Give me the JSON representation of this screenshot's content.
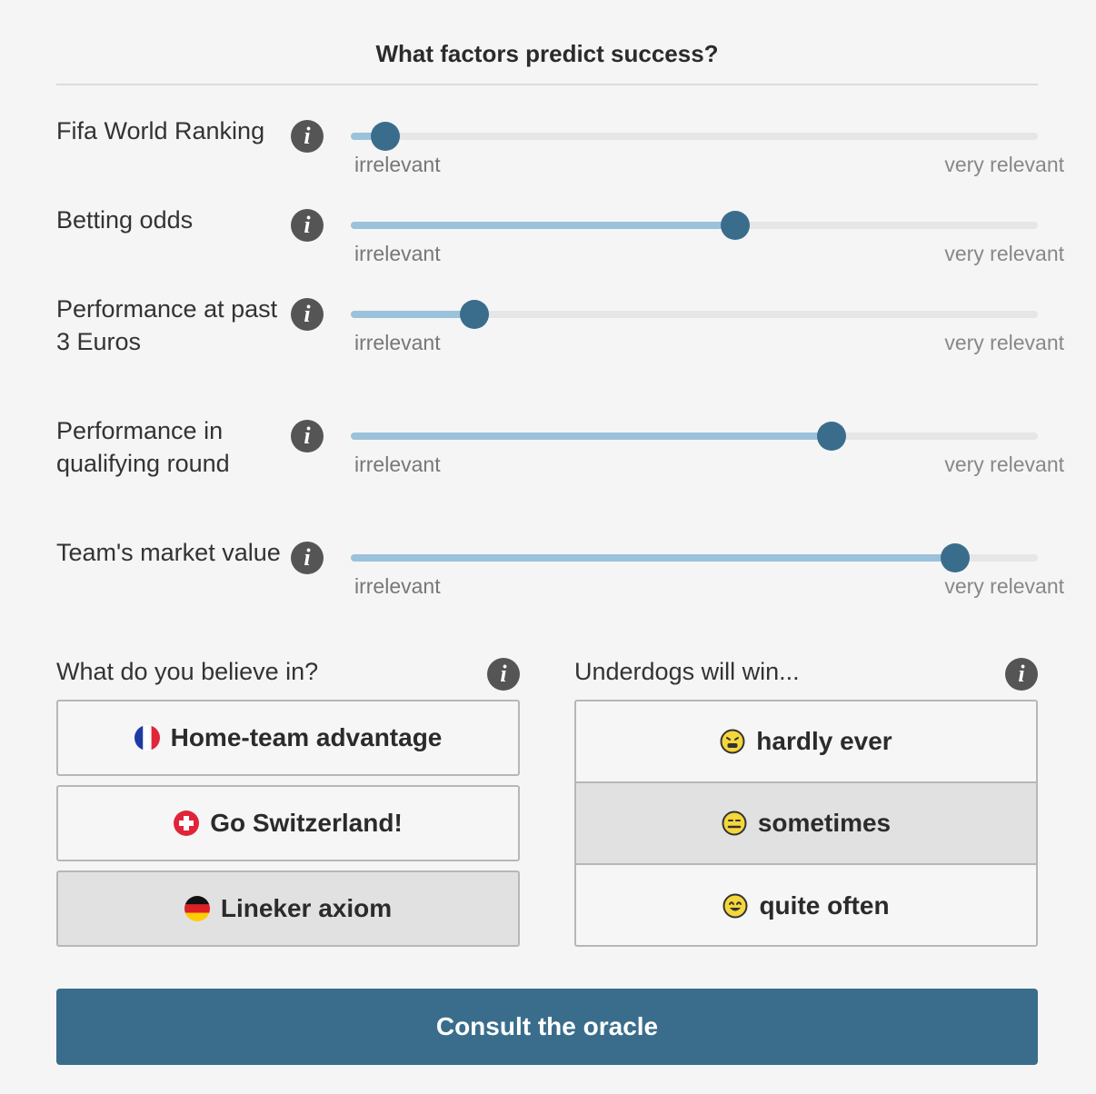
{
  "header": {
    "title": "What factors predict success?"
  },
  "colors": {
    "accent": "#3a6d8c",
    "fill": "#9bc2da",
    "track": "#e6e6e6"
  },
  "factors": [
    {
      "label": "Fifa World Ranking",
      "value": 0.05,
      "min_label": "irrelevant",
      "max_label": "very relevant"
    },
    {
      "label": "Betting odds",
      "value": 0.56,
      "min_label": "irrelevant",
      "max_label": "very relevant"
    },
    {
      "label": "Performance at past 3 Euros",
      "value": 0.18,
      "min_label": "irrelevant",
      "max_label": "very relevant"
    },
    {
      "label": "Performance in qualifying round",
      "value": 0.7,
      "min_label": "irrelevant",
      "max_label": "very relevant"
    },
    {
      "label": "Team's market value",
      "value": 0.88,
      "min_label": "irrelevant",
      "max_label": "very relevant"
    }
  ],
  "beliefs": {
    "label": "What do you believe in?",
    "options": [
      {
        "label": "Home-team advantage",
        "icon": "france-flag-icon",
        "selected": false
      },
      {
        "label": "Go Switzerland!",
        "icon": "swiss-cross-icon",
        "selected": false
      },
      {
        "label": "Lineker axiom",
        "icon": "germany-flag-icon",
        "selected": true
      }
    ]
  },
  "underdogs": {
    "label": "Underdogs will win...",
    "options": [
      {
        "label": "hardly ever",
        "icon": "sad-face-icon",
        "selected": false
      },
      {
        "label": "sometimes",
        "icon": "neutral-face-icon",
        "selected": true
      },
      {
        "label": "quite often",
        "icon": "happy-face-icon",
        "selected": false
      }
    ]
  },
  "info_glyph": "i",
  "submit": {
    "label": "Consult the oracle"
  }
}
